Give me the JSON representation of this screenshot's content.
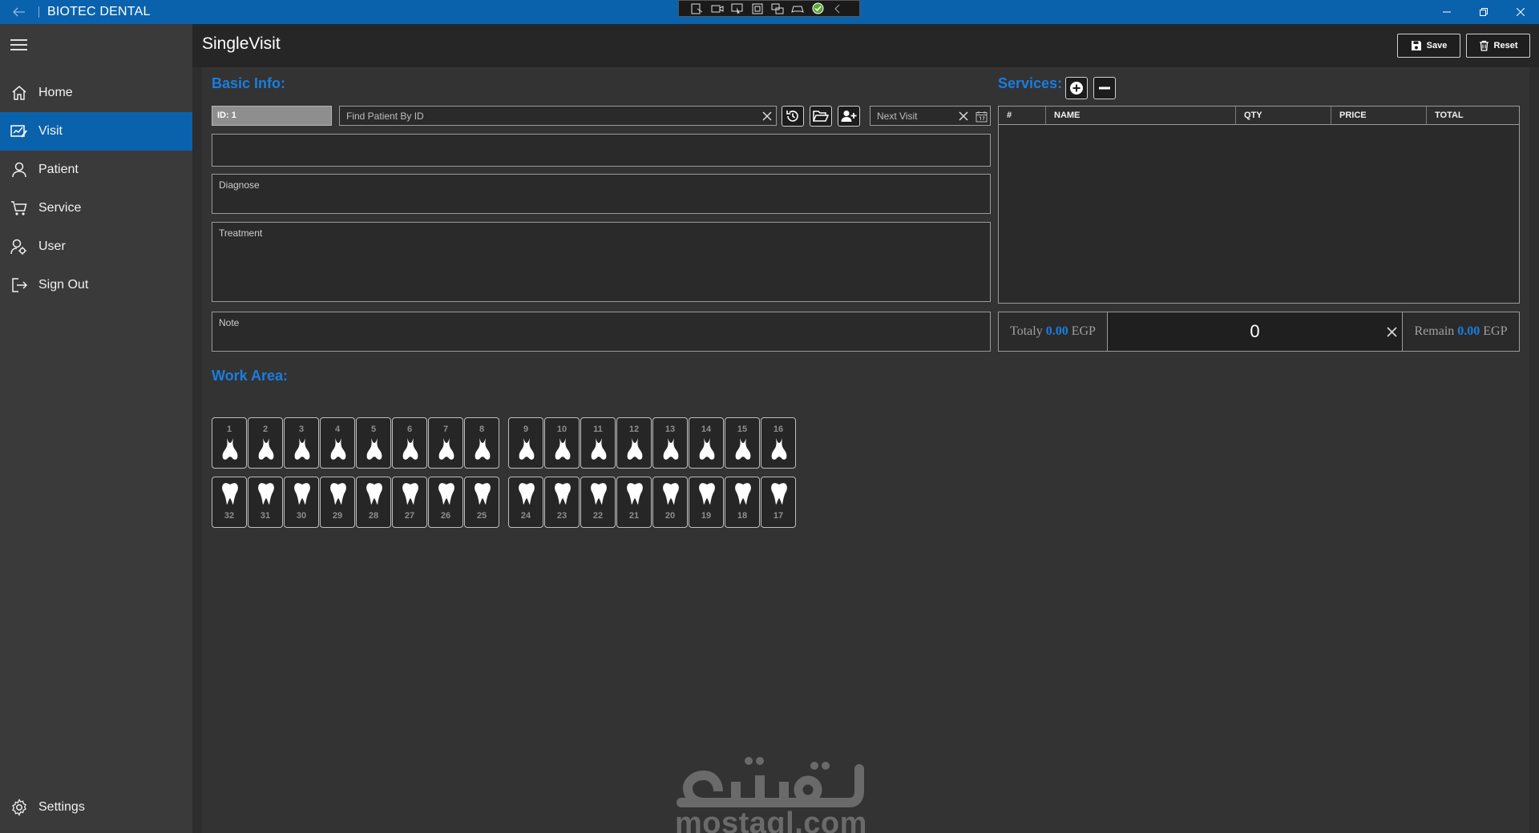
{
  "app": {
    "title": "BIOTEC DENTAL"
  },
  "sidebar": {
    "items": [
      {
        "label": "Home",
        "icon": "home-icon"
      },
      {
        "label": "Visit",
        "icon": "visit-icon",
        "active": true
      },
      {
        "label": "Patient",
        "icon": "user-icon"
      },
      {
        "label": "Service",
        "icon": "cart-icon"
      },
      {
        "label": "User",
        "icon": "user-key-icon"
      },
      {
        "label": "Sign Out",
        "icon": "sign-out-icon"
      }
    ],
    "settings_label": "Settings"
  },
  "header": {
    "title": "SingleVisit",
    "save_label": "Save",
    "reset_label": "Reset"
  },
  "basic_info": {
    "title": "Basic Info:",
    "id_value": "ID: 1",
    "search_placeholder": "Find Patient By ID",
    "next_visit_placeholder": "Next Visit",
    "diagnose_label": "Diagnose",
    "treatment_label": "Treatment",
    "note_label": "Note"
  },
  "services": {
    "title": "Services:",
    "columns": [
      "#",
      "NAME",
      "QTY",
      "PRICE",
      "TOTAL"
    ],
    "rows": []
  },
  "totals": {
    "totaly_label": "Totaly",
    "totaly_value": "0.00",
    "currency": "EGP",
    "amount": "0",
    "remain_label": "Remain",
    "remain_value": "0.00"
  },
  "work_area": {
    "title": "Work Area:",
    "upper_left": [
      "1",
      "2",
      "3",
      "4",
      "5",
      "6",
      "7",
      "8"
    ],
    "upper_right": [
      "9",
      "10",
      "11",
      "12",
      "13",
      "14",
      "15",
      "16"
    ],
    "lower_left": [
      "32",
      "31",
      "30",
      "29",
      "28",
      "27",
      "26",
      "25"
    ],
    "lower_right": [
      "24",
      "23",
      "22",
      "21",
      "20",
      "19",
      "18",
      "17"
    ]
  },
  "watermark": {
    "text": "mostaql.com"
  },
  "colors": {
    "accent": "#0a62ad",
    "heading": "#1a7de0",
    "background": "#333333"
  }
}
